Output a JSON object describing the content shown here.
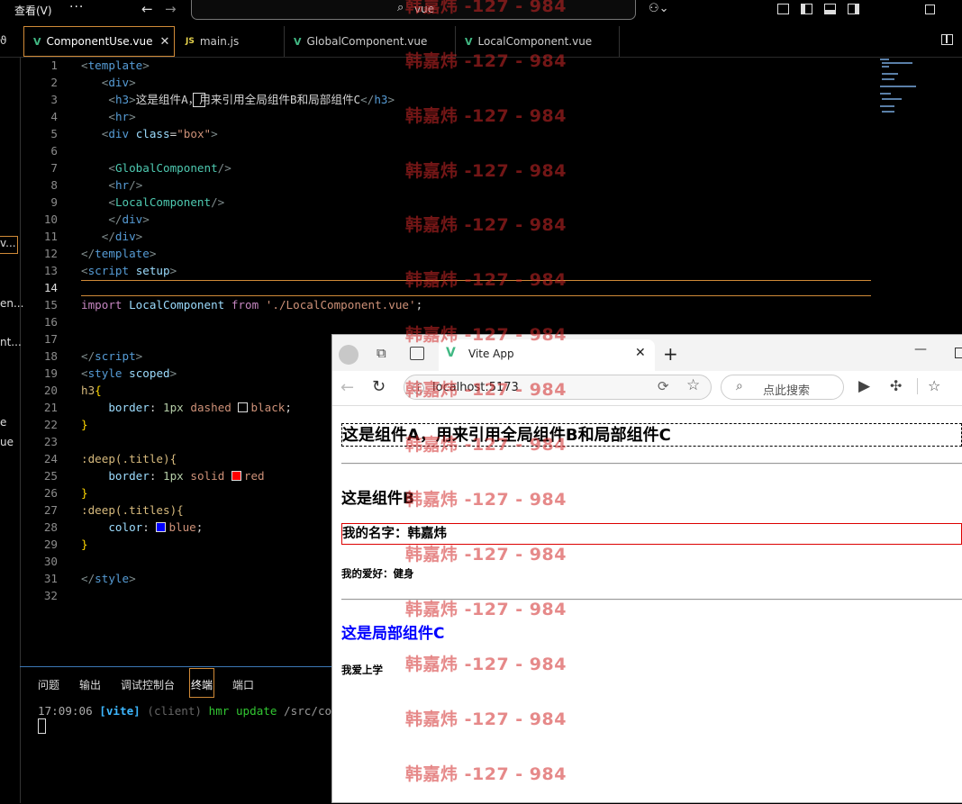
{
  "titlebar": {
    "menu_view": "查看(V)",
    "menu_more": "···",
    "search_text": "vue"
  },
  "tabs": [
    {
      "label": "ComponentUse.vue",
      "lang": "vue",
      "active": true
    },
    {
      "label": "main.js",
      "lang": "js",
      "active": false
    },
    {
      "label": "GlobalComponent.vue",
      "lang": "vue",
      "active": false
    },
    {
      "label": "LocalComponent.vue",
      "lang": "vue",
      "active": false
    }
  ],
  "sidebar": {
    "fragments": [
      "v...",
      "en...",
      "nt...",
      "e",
      "ue"
    ]
  },
  "editor": {
    "current_line": 14,
    "lines": [
      "1",
      "2",
      "3",
      "4",
      "5",
      "6",
      "7",
      "8",
      "9",
      "10",
      "11",
      "12",
      "13",
      "14",
      "15",
      "16",
      "17",
      "18",
      "19",
      "20",
      "21",
      "22",
      "23",
      "24",
      "25",
      "26",
      "27",
      "28",
      "29",
      "30",
      "31",
      "32"
    ],
    "code": {
      "h3_text": "这是组件A，用来引用全局组件B和局部组件C",
      "div_class": "\"box\"",
      "import_path": "'./LocalComponent.vue'",
      "border_dashed": "dashed",
      "color_black": "black",
      "border_solid": "solid",
      "color_red": "red",
      "color_blue": "blue",
      "selector_title": ":deep(.title){",
      "selector_titles": ":deep(.titles){"
    },
    "swatch_colors": {
      "black": "#000000",
      "red": "#ff0000",
      "blue": "#0000ff"
    }
  },
  "panel": {
    "tabs": [
      "问题",
      "输出",
      "调试控制台",
      "终端",
      "端口"
    ],
    "active_tab": "终端",
    "terminal": {
      "time": "17:09:06",
      "tag": "[vite]",
      "client": "(client)",
      "msg": "hmr update",
      "path": "/src/compon"
    }
  },
  "browser": {
    "tab_title": "Vite App",
    "url": "localhost:5173",
    "search_placeholder": "点此搜索",
    "page": {
      "heading_a": "这是组件A，用来引用全局组件B和局部组件C",
      "heading_b": "这是组件B",
      "name_line": "我的名字：韩嘉炜",
      "hobby_line": "我的爱好：健身",
      "heading_c": "这是局部组件C",
      "study_line": "我爱上学"
    }
  },
  "watermark": {
    "text": "韩嘉炜 -127 - 984"
  }
}
